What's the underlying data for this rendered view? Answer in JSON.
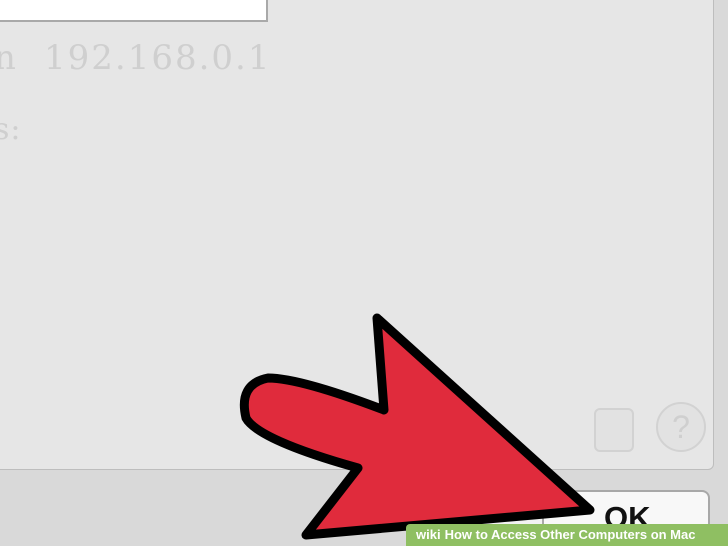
{
  "dialog": {
    "address_label_fragment": "n",
    "address_value": "192.168.0.1",
    "second_label_fragment": "s:",
    "help_label": "?",
    "ok_label": "OK"
  },
  "banner": {
    "logo": "wiki",
    "title": "How to Access Other Computers on Mac"
  },
  "colors": {
    "arrow_fill": "#e02b3c",
    "arrow_stroke": "#000000",
    "banner_bg": "#8fbf62"
  }
}
